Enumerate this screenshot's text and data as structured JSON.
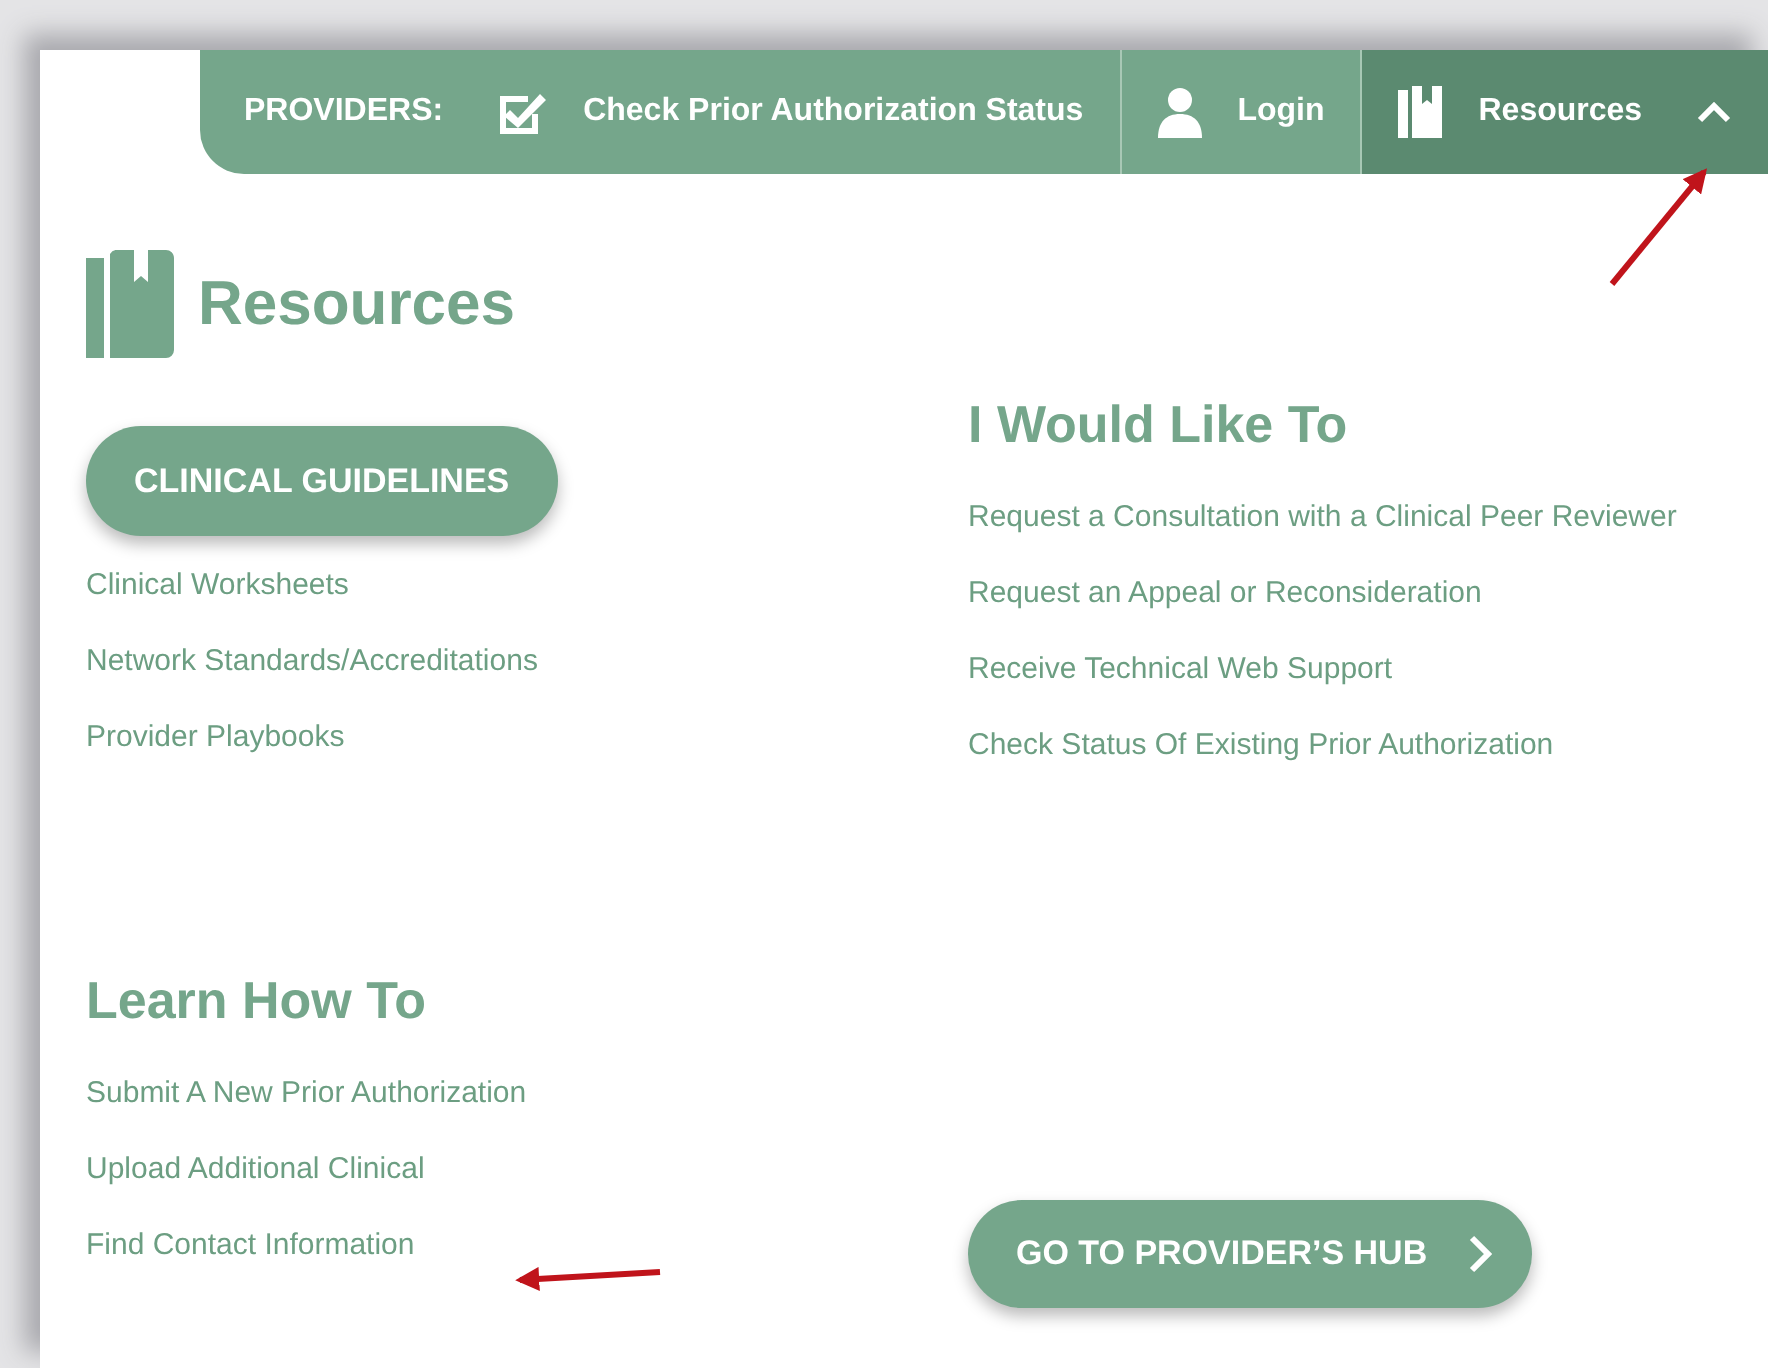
{
  "nav": {
    "label": "PROVIDERS:",
    "expanded": true,
    "items": [
      {
        "kind": "checkbox",
        "label": "Check Prior Authorization Status",
        "selected": false
      },
      {
        "kind": "person",
        "label": "Login",
        "selected": false
      },
      {
        "kind": "book",
        "label": "Resources",
        "selected": true
      }
    ]
  },
  "panel": {
    "title": "Resources",
    "primary_button": "CLINICAL GUIDELINES",
    "resource_links": [
      "Clinical Worksheets",
      "Network Standards/Accreditations",
      "Provider Playbooks"
    ],
    "would_like": {
      "title": "I Would Like To",
      "links": [
        "Request a Consultation with a Clinical Peer Reviewer",
        "Request an Appeal or Reconsideration",
        "Receive Technical Web Support",
        "Check Status Of Existing Prior Authorization"
      ]
    },
    "learn": {
      "title": "Learn How To",
      "links": [
        "Submit A New Prior Authorization",
        "Upload Additional Clinical",
        "Find Contact Information"
      ]
    },
    "hub_button": "GO TO PROVIDER’S HUB"
  }
}
